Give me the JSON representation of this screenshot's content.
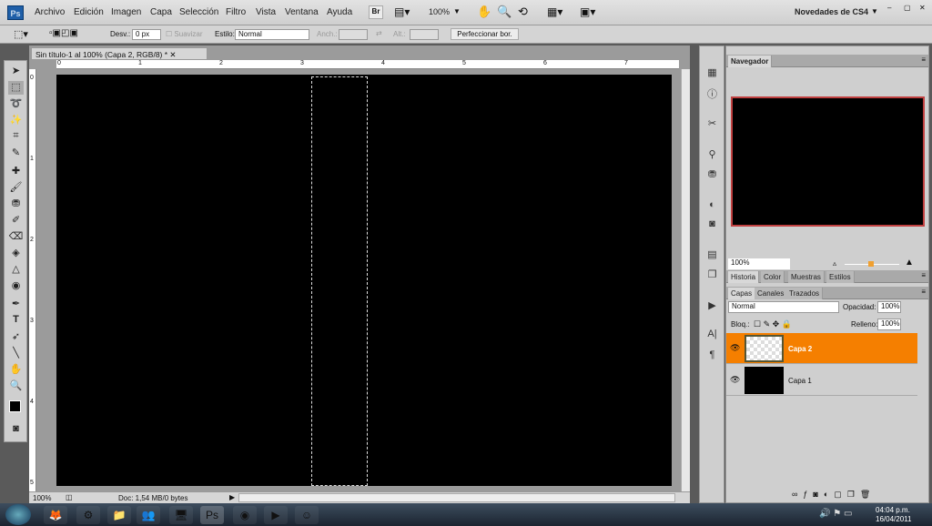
{
  "menubar": {
    "logo": "Ps",
    "items": [
      "Archivo",
      "Edición",
      "Imagen",
      "Capa",
      "Selección",
      "Filtro",
      "Vista",
      "Ventana",
      "Ayuda"
    ],
    "bridge": "Br",
    "zoom": "100%",
    "workspace": "Novedades de CS4"
  },
  "options": {
    "feather_label": "Desv.:",
    "feather_value": "0 px",
    "antialias": "Suavizar",
    "style_label": "Estilo:",
    "style_value": "Normal",
    "width_label": "Anch.:",
    "height_label": "Alt.:",
    "refine": "Perfeccionar bor."
  },
  "document": {
    "tab_title": "Sin título-1 al 100% (Capa 2, RGB/8) *",
    "ruler_top": [
      "0",
      "1",
      "2",
      "3",
      "4",
      "5",
      "6",
      "7"
    ],
    "ruler_left": [
      "0",
      "1",
      "2",
      "3",
      "4",
      "5"
    ],
    "zoom": "100%",
    "doc_info": "Doc: 1,54 MB/0 bytes"
  },
  "navigator": {
    "title": "Navegador",
    "zoom": "100%"
  },
  "panel_group2": {
    "tabs": [
      "Historia",
      "Color",
      "Muestras",
      "Estilos"
    ]
  },
  "layers": {
    "tabs": [
      "Capas",
      "Canales",
      "Trazados"
    ],
    "blend_mode": "Normal",
    "opacity_label": "Opacidad:",
    "opacity": "100%",
    "lock_label": "Bloq.:",
    "fill_label": "Relleno:",
    "fill": "100%",
    "items": [
      {
        "name": "Capa 2",
        "selected": true
      },
      {
        "name": "Capa 1",
        "selected": false
      }
    ]
  },
  "taskbar": {
    "time": "04:04 p.m.",
    "date": "16/04/2011"
  },
  "colors": {
    "accent": "#f57f00",
    "nav_border": "#c04040"
  }
}
